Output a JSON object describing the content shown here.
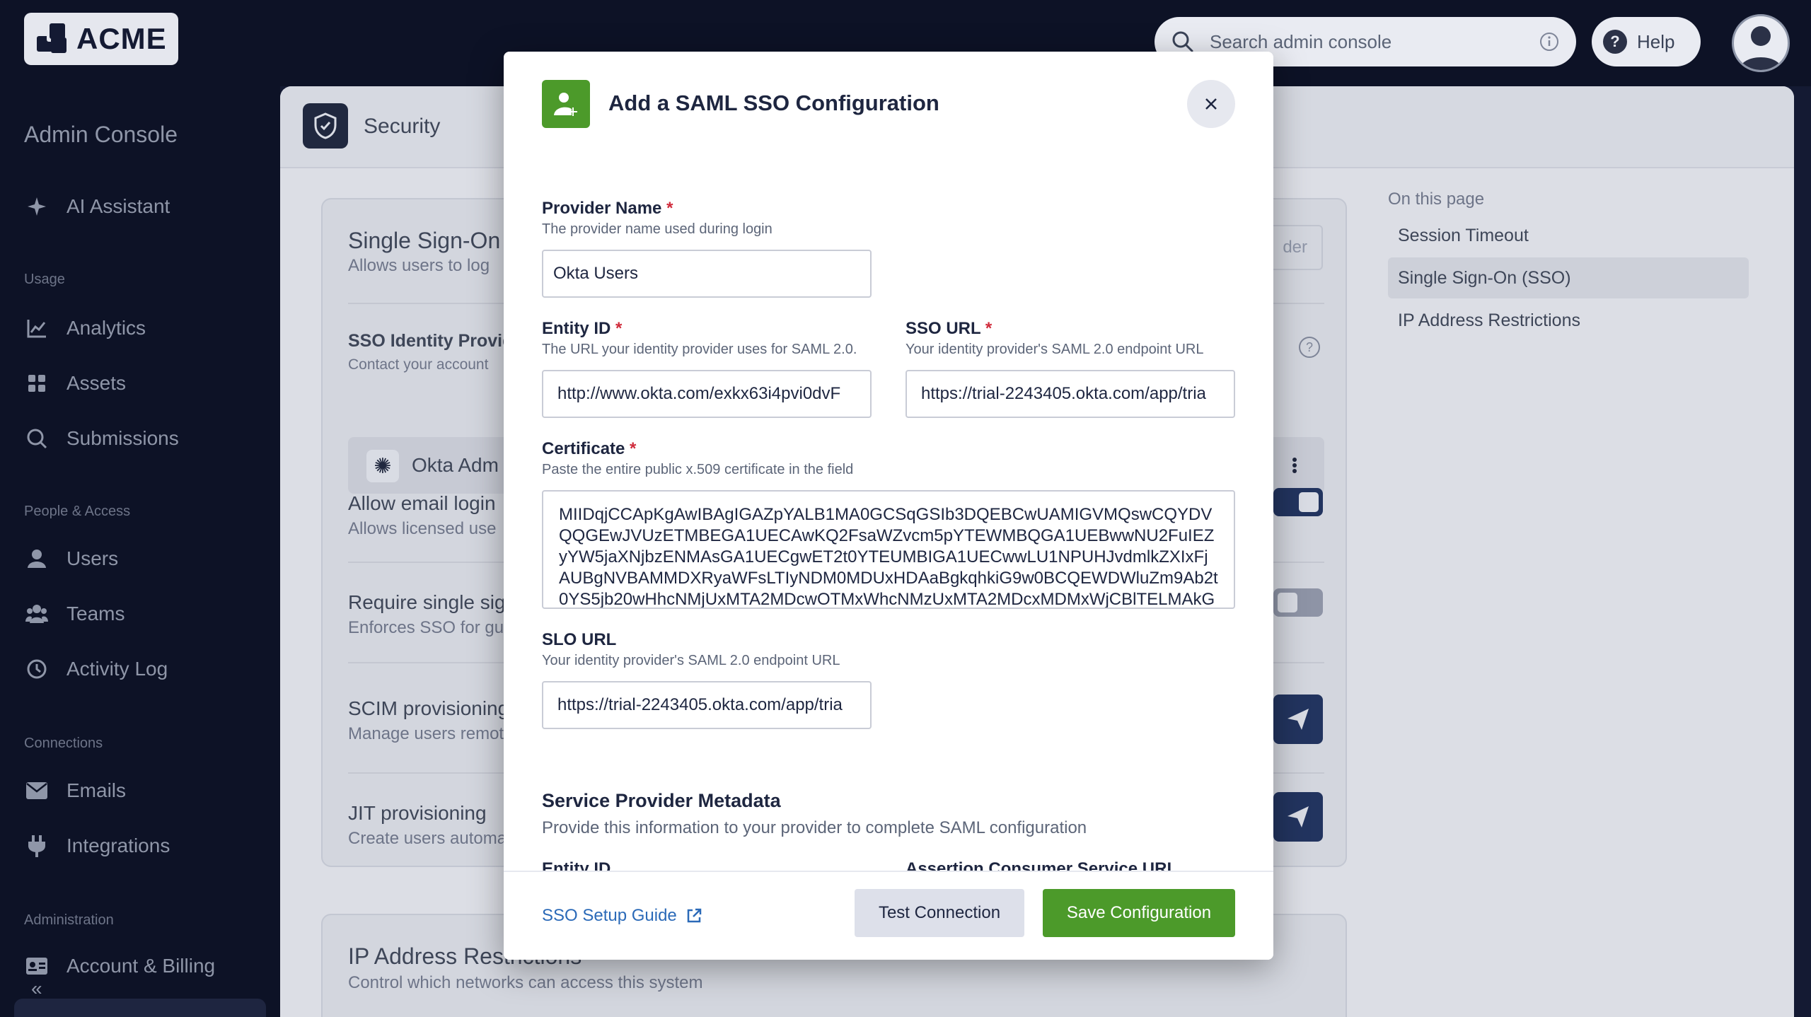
{
  "app": {
    "brand": "ACME",
    "search_placeholder": "Search admin console",
    "help_label": "Help"
  },
  "sidebar": {
    "title": "Admin Console",
    "ai_assistant": "AI Assistant",
    "sections": {
      "usage": "Usage",
      "people": "People & Access",
      "connections": "Connections",
      "administration": "Administration"
    },
    "items": {
      "analytics": "Analytics",
      "assets": "Assets",
      "submissions": "Submissions",
      "users": "Users",
      "teams": "Teams",
      "activity_log": "Activity Log",
      "emails": "Emails",
      "integrations": "Integrations",
      "account_billing": "Account & Billing"
    }
  },
  "page": {
    "title": "Security",
    "sso_card": {
      "title": "Single Sign-On",
      "subtitle": "Allows users to log",
      "idp_title": "SSO Identity Provid",
      "idp_sub": "Contact your account",
      "idp_name": "Okta Adm",
      "idp_btn": "der",
      "email_login_title": "Allow email login",
      "email_login_sub": "Allows licensed use",
      "require_sso_title": "Require single sig",
      "require_sso_sub": "Enforces SSO for gu",
      "scim_title": "SCIM provisioning",
      "scim_sub": "Manage users remot",
      "jit_title": "JIT provisioning",
      "jit_sub": "Create users automa"
    },
    "ip_card": {
      "title": "IP Address Restrictions",
      "subtitle": "Control which networks can access this system"
    },
    "on_this_page": {
      "title": "On this page",
      "items": [
        "Session Timeout",
        "Single Sign-On (SSO)",
        "IP Address Restrictions"
      ]
    }
  },
  "modal": {
    "title": "Add a SAML SSO Configuration",
    "provider_name": {
      "label": "Provider Name",
      "help": "The provider name used during login",
      "value": "Okta Users"
    },
    "entity_id": {
      "label": "Entity ID",
      "help": "The URL your identity provider uses for SAML 2.0.",
      "value": "http://www.okta.com/exkx63i4pvi0dvF"
    },
    "sso_url": {
      "label": "SSO URL",
      "help": "Your identity provider's SAML 2.0 endpoint URL",
      "value": "https://trial-2243405.okta.com/app/tria"
    },
    "certificate": {
      "label": "Certificate",
      "help": "Paste the entire public x.509 certificate in the field",
      "value": "MIIDqjCCApKgAwIBAgIGAZpYALB1MA0GCSqGSIb3DQEBCwUAMIGVMQswCQYDVQQGEwJVUzETMBEGA1UECAwKQ2FsaWZvcm5pYTEWMBQGA1UEBwwNU2FuIEZyYW5jaXNjbzENMAsGA1UECgwET2t0YTEUMBIGA1UECwwLU1NPUHJvdmlkZXIxFjAUBgNVBAMMDXRyaWFsLTIyNDM0MDUxHDAaBgkqhkiG9w0BCQEWDWluZm9Ab2t0YS5jb20wHhcNMjUxMTA2MDcwOTMxWhcNMzUxMTA2MDcxMDMxWjCBlTELMAkG"
    },
    "slo_url": {
      "label": "SLO URL",
      "help": "Your identity provider's SAML 2.0 endpoint URL",
      "value": "https://trial-2243405.okta.com/app/tria"
    },
    "sp_metadata": {
      "title": "Service Provider Metadata",
      "desc": "Provide this information to your provider to complete SAML configuration",
      "entity_id_label": "Entity ID",
      "acs_label": "Assertion Consumer Service URL"
    },
    "footer": {
      "guide": "SSO Setup Guide",
      "test": "Test Connection",
      "save": "Save Configuration"
    }
  },
  "colors": {
    "accent_green": "#4c9a2a",
    "link_blue": "#2b6ab8",
    "navy": "#0d1226",
    "required": "#d02b3b"
  }
}
